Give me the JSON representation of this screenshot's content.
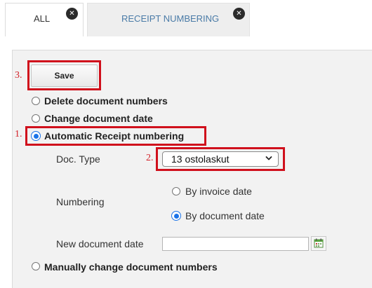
{
  "tabs": [
    {
      "label": "ALL",
      "active": false
    },
    {
      "label": "RECEIPT NUMBERING",
      "active": true
    }
  ],
  "markers": {
    "one": "1.",
    "two": "2.",
    "three": "3."
  },
  "toolbar": {
    "save_label": "Save"
  },
  "options": {
    "delete_numbers": "Delete document numbers",
    "change_date": "Change document date",
    "automatic_numbering": "Automatic Receipt numbering",
    "manual_change": "Manually change document numbers"
  },
  "selected_option": "automatic_numbering",
  "form": {
    "doc_type_label": "Doc. Type",
    "doc_type_value": "13 ostolaskut",
    "numbering_label": "Numbering",
    "numbering_options": [
      "By invoice date",
      "By document date"
    ],
    "numbering_selected": "By document date",
    "new_date_label": "New document date",
    "new_date_value": ""
  },
  "colors": {
    "highlight": "#d0101c",
    "marker": "#d21f27",
    "radio_accent": "#1a73e8",
    "tab_active_text": "#4a7ba7"
  },
  "icons": {
    "close": "close-icon",
    "dropdown": "chevron-down-icon",
    "calendar": "calendar-icon"
  }
}
